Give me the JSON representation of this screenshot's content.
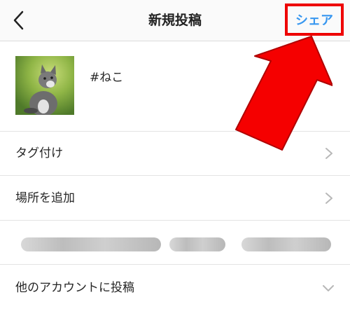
{
  "header": {
    "title": "新規投稿",
    "share_label": "シェア"
  },
  "post": {
    "caption": "#ねこ"
  },
  "rows": {
    "tag_label": "タグ付け",
    "location_label": "場所を追加",
    "other_accounts_label": "他のアカウントに投稿"
  },
  "colors": {
    "share_text": "#3897f0",
    "highlight": "#ee0000"
  },
  "icons": [
    "back-icon",
    "chevron-right-icon",
    "chevron-down-icon",
    "red-arrow-annotation"
  ]
}
